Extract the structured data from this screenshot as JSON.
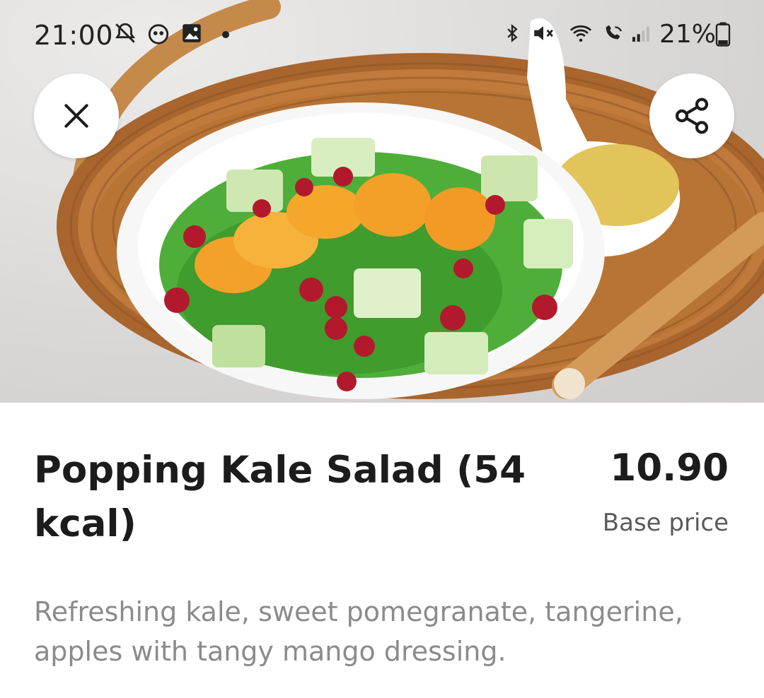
{
  "status_bar": {
    "time": "21:00",
    "battery": "21%",
    "left_icons": [
      "notifications-off-icon",
      "app-icon",
      "image-icon",
      "dot-icon"
    ],
    "right_icons": [
      "bluetooth-icon",
      "mute-icon",
      "wifi-icon",
      "wifi-calling-icon",
      "signal-icon",
      "battery-icon"
    ]
  },
  "hero": {
    "icon_close": "close-icon",
    "icon_share": "share-icon"
  },
  "product": {
    "title": "Popping Kale Salad (54 kcal)",
    "price": "10.90",
    "price_label": "Base price",
    "description": "Refreshing kale, sweet pomegranate, tangerine, apples with tangy mango dressing."
  },
  "colors": {
    "text_primary": "#1c1c1c",
    "text_secondary": "#5a5a5a",
    "text_muted": "#8b8b8b",
    "button_bg": "#ffffff"
  }
}
